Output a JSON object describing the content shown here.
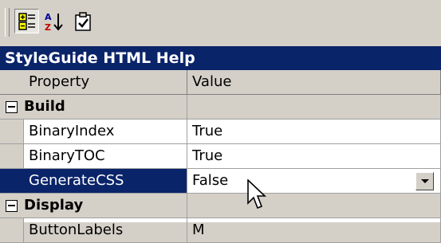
{
  "toolbar": {
    "buttons": [
      {
        "name": "categorized-icon",
        "pressed": true
      },
      {
        "name": "sort-alphabetical-icon",
        "pressed": false
      },
      {
        "name": "property-pages-icon",
        "pressed": false
      }
    ]
  },
  "title": "StyleGuide HTML Help",
  "grid": {
    "headers": {
      "property": "Property",
      "value": "Value"
    },
    "categories": [
      {
        "label": "Build",
        "rows": [
          {
            "property": "BinaryIndex",
            "value": "True"
          },
          {
            "property": "BinaryTOC",
            "value": "True"
          },
          {
            "property": "GenerateCSS",
            "value": "False",
            "selected": true
          }
        ]
      },
      {
        "label": "Display",
        "rows": [
          {
            "property": "ButtonLabels",
            "value": "M"
          }
        ]
      }
    ]
  },
  "colors": {
    "selection": "#0a246a",
    "face": "#d4d0c8"
  }
}
